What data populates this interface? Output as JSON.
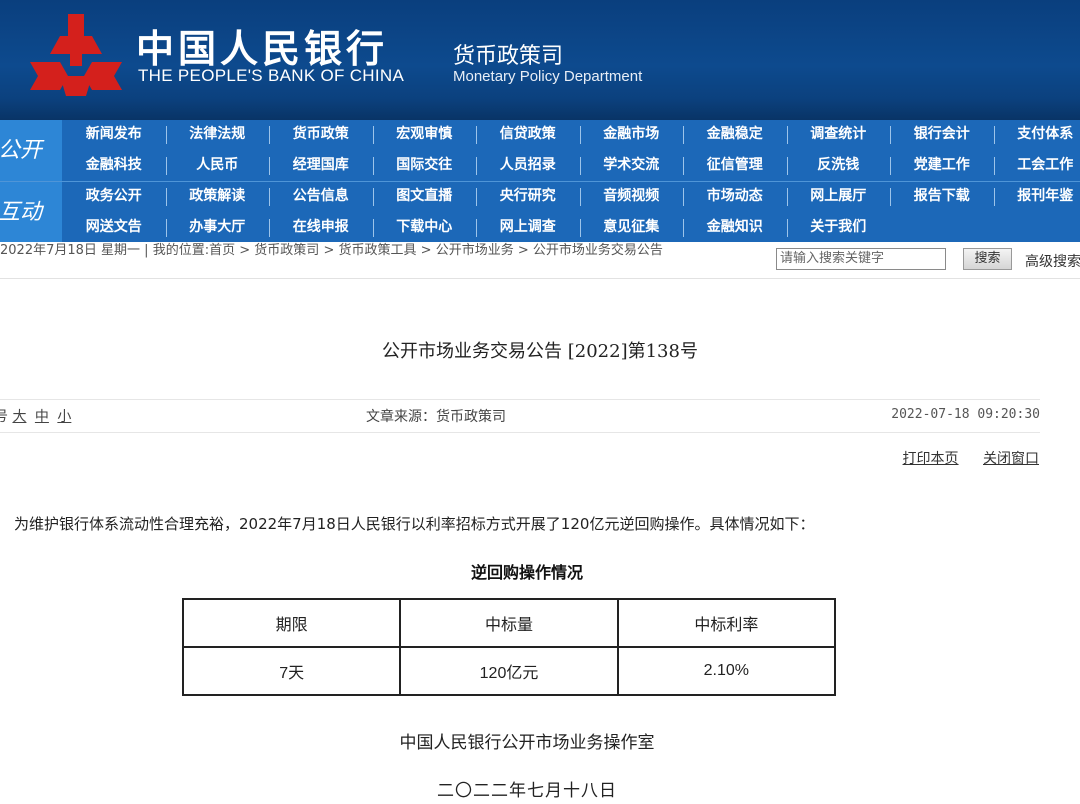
{
  "header": {
    "bank_name_cn": "中国人民银行",
    "bank_name_en": "THE PEOPLE'S BANK OF CHINA",
    "dept_cn": "货币政策司",
    "dept_en": "Monetary Policy Department",
    "logo_icon": "pboc-logo-icon",
    "logo_color": "#d4201c"
  },
  "nav": {
    "public_label": "公开",
    "interact_label": "互动",
    "public_row1": [
      "新闻发布",
      "法律法规",
      "货币政策",
      "宏观审慎",
      "信贷政策",
      "金融市场",
      "金融稳定",
      "调查统计",
      "银行会计",
      "支付体系"
    ],
    "public_row2": [
      "金融科技",
      "人民币",
      "经理国库",
      "国际交往",
      "人员招录",
      "学术交流",
      "征信管理",
      "反洗钱",
      "党建工作",
      "工会工作"
    ],
    "interact_row1": [
      "政务公开",
      "政策解读",
      "公告信息",
      "图文直播",
      "央行研究",
      "音频视频",
      "市场动态",
      "网上展厅",
      "报告下载",
      "报刊年鉴"
    ],
    "interact_row2": [
      "网送文告",
      "办事大厅",
      "在线申报",
      "下载中心",
      "网上调查",
      "意见征集",
      "金融知识",
      "关于我们"
    ]
  },
  "breadcrumb": {
    "date": "2022年7月18日 星期一",
    "sep": " | ",
    "location_label": "我的位置:",
    "items": [
      "首页",
      "货币政策司",
      "货币政策工具",
      "公开市场业务",
      "公开市场业务交易公告"
    ],
    "arrow": ">"
  },
  "search": {
    "placeholder": "请输入搜索关键字",
    "button": "搜索",
    "advanced": "高级搜索"
  },
  "article": {
    "title": "公开市场业务交易公告 [2022]第138号",
    "font_label": "号",
    "font_large": "大",
    "font_medium": "中",
    "font_small": "小",
    "source": "文章来源：货币政策司",
    "time": "2022-07-18 09:20:30",
    "print": "打印本页",
    "close": "关闭窗口",
    "paragraph": "为维护银行体系流动性合理充裕，2022年7月18日人民银行以利率招标方式开展了120亿元逆回购操作。具体情况如下：",
    "table_caption": "逆回购操作情况",
    "table": {
      "headers": [
        "期限",
        "中标量",
        "中标利率"
      ],
      "rows": [
        [
          "7天",
          "120亿元",
          "2.10%"
        ]
      ]
    },
    "signature": "中国人民银行公开市场业务操作室",
    "date": "二〇二二年七月十八日"
  }
}
